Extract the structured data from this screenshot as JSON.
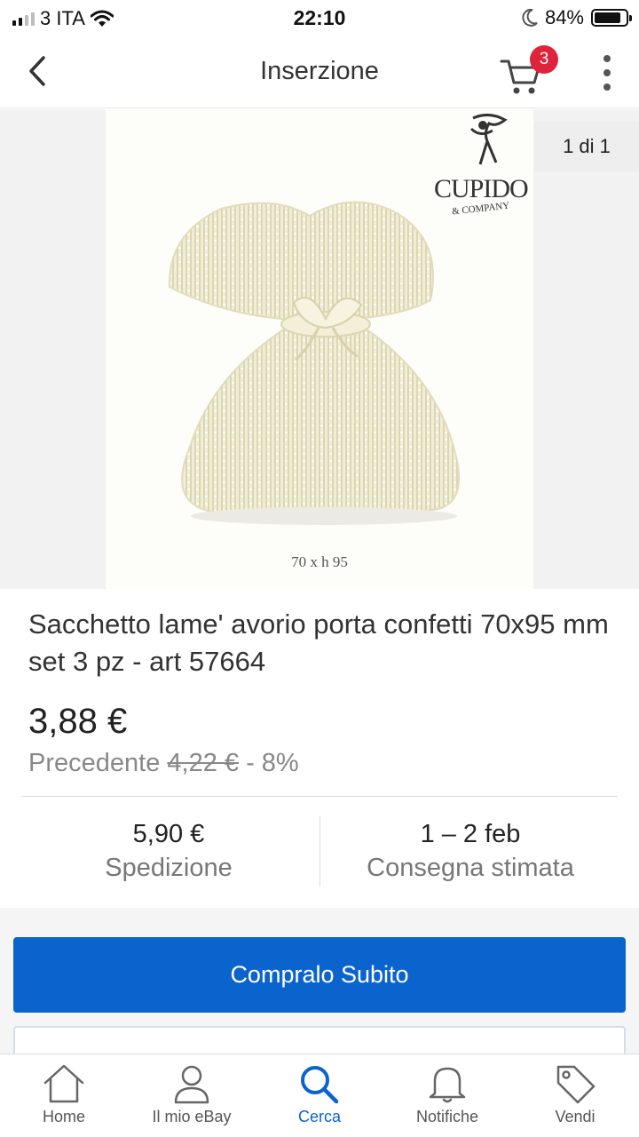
{
  "status_bar": {
    "carrier": "3 ITA",
    "time": "22:10",
    "battery": "84%",
    "battery_level": 0.84
  },
  "nav": {
    "title": "Inserzione",
    "cart_count": "3"
  },
  "gallery": {
    "counter": "1 di 1",
    "caption": "70 x h 95",
    "brand_name": "CUPIDO",
    "brand_sub": "& COMPANY"
  },
  "product": {
    "title": "Sacchetto lame' avorio porta confetti 70x95 mm set 3 pz -  art 57664",
    "price": "3,88 €",
    "previous_label": "Precedente",
    "previous_price": "4,22 €",
    "discount": "- 8%"
  },
  "shipping": {
    "cost": "5,90 €",
    "cost_label": "Spedizione",
    "delivery": "1 – 2 feb",
    "delivery_label": "Consegna stimata"
  },
  "actions": {
    "buy_now": "Compralo Subito"
  },
  "tabs": [
    {
      "label": "Home",
      "icon": "home-icon"
    },
    {
      "label": "Il mio eBay",
      "icon": "user-icon"
    },
    {
      "label": "Cerca",
      "icon": "search-icon"
    },
    {
      "label": "Notifiche",
      "icon": "bell-icon"
    },
    {
      "label": "Vendi",
      "icon": "tag-icon"
    }
  ],
  "colors": {
    "accent": "#0b63ce",
    "badge": "#e0223b"
  }
}
